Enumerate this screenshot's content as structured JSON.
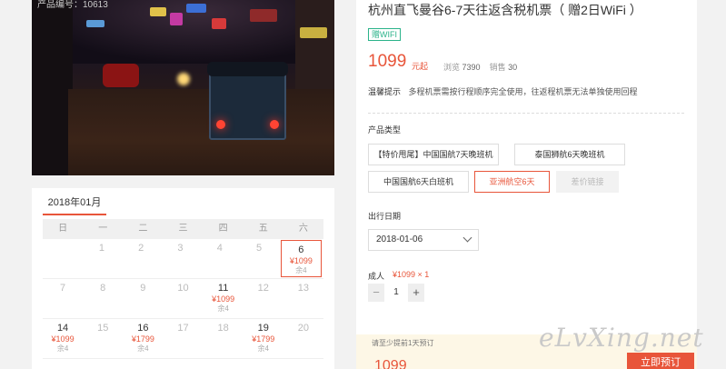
{
  "photo": {
    "alt": "bangkok-night-street-photo",
    "caption": "产品编号：10613"
  },
  "calendar": {
    "month": "2018年01月",
    "weekdays": [
      "日",
      "一",
      "二",
      "三",
      "四",
      "五",
      "六"
    ],
    "rows": [
      [
        {
          "day": ""
        },
        {
          "day": "1"
        },
        {
          "day": "2"
        },
        {
          "day": "3"
        },
        {
          "day": "4"
        },
        {
          "day": "5"
        },
        {
          "day": "6",
          "price": "¥1099",
          "stock": "余4",
          "selected": true
        }
      ],
      [
        {
          "day": "7"
        },
        {
          "day": "8"
        },
        {
          "day": "9"
        },
        {
          "day": "10"
        },
        {
          "day": "11",
          "price": "¥1099",
          "stock": "余4"
        },
        {
          "day": "12"
        },
        {
          "day": "13"
        }
      ],
      [
        {
          "day": "14",
          "price": "¥1099",
          "stock": "余4"
        },
        {
          "day": "15"
        },
        {
          "day": "16",
          "price": "¥1799",
          "stock": "余4"
        },
        {
          "day": "17"
        },
        {
          "day": "18"
        },
        {
          "day": "19",
          "price": "¥1799",
          "stock": "余4"
        },
        {
          "day": "20"
        }
      ]
    ]
  },
  "product": {
    "title": "杭州直飞曼谷6-7天往返含税机票（ 赠2日WiFi ）",
    "gift_tag": "赠WIFI",
    "price": "1099",
    "price_unit": "元起",
    "views_label": "浏览",
    "views": "7390",
    "sales_label": "销售",
    "sales": "30",
    "notice_label": "温馨提示",
    "notice_text": "多程机票需按行程顺序完全使用，往返程机票无法单独使用回程"
  },
  "options": {
    "label": "产品类型",
    "items": [
      {
        "label": "【特价甩尾】中国国航7天晚班机",
        "state": "normal"
      },
      {
        "label": "泰国狮航6天晚班机",
        "state": "normal"
      },
      {
        "label": "中国国航6天白班机",
        "state": "normal"
      },
      {
        "label": "亚洲航空6天",
        "state": "selected"
      },
      {
        "label": "差价链接",
        "state": "disabled"
      }
    ]
  },
  "departure": {
    "label": "出行日期",
    "value": "2018-01-06"
  },
  "adult": {
    "label": "成人",
    "price": "¥1099 × 1",
    "quantity": "1",
    "minus": "−",
    "plus": "+"
  },
  "footer": {
    "tip": "请至少提前1天预订",
    "total": "1099",
    "book_label": "立即预订"
  },
  "watermark": "eLvXing.net",
  "colors": {
    "accent": "#e8553a",
    "green_tag": "#2bb38a"
  }
}
